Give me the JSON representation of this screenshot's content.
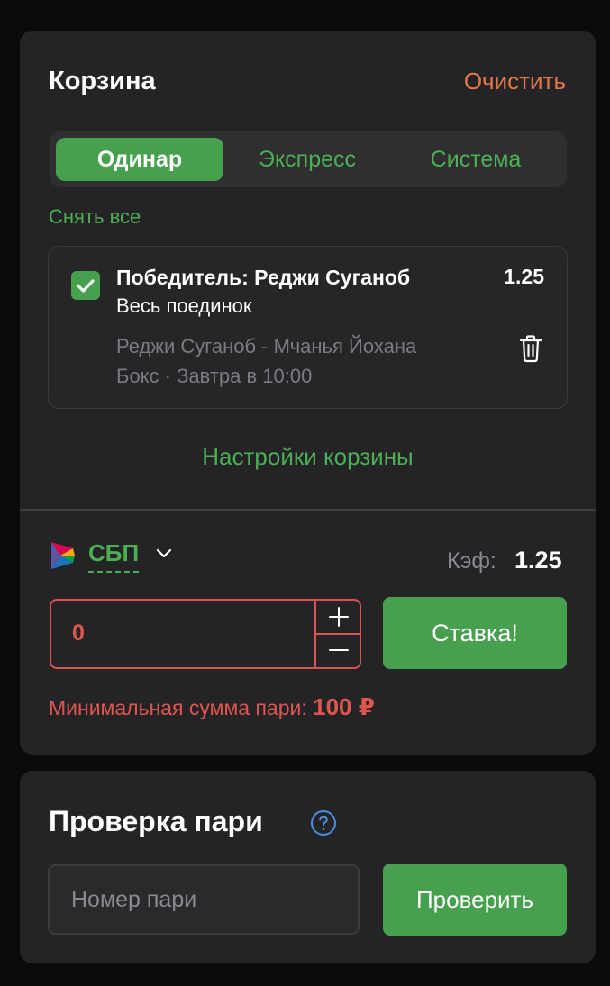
{
  "basket": {
    "title": "Корзина",
    "clear_label": "Очистить",
    "tabs": [
      {
        "label": "Одинар",
        "active": true
      },
      {
        "label": "Экспресс",
        "active": false
      },
      {
        "label": "Система",
        "active": false
      }
    ],
    "remove_all_label": "Снять все",
    "items": [
      {
        "checked": true,
        "title": "Победитель: Реджи Суганоб",
        "odds": "1.25",
        "market": "Весь поединок",
        "event": "Реджи Суганоб - Мчанья Йохана",
        "sport_time": "Бокс · Завтра в 10:00",
        "delete_icon": "trash-icon"
      }
    ],
    "settings_label": "Настройки корзины",
    "payment": {
      "method": "СБП",
      "logo_icon": "sbp-logo-icon",
      "chevron_icon": "chevron-down-icon"
    },
    "coef_label": "Кэф:",
    "coef_value": "1.25",
    "amount_value": "0",
    "stake_button": "Ставка!",
    "min_sum_label": "Минимальная сумма пари:",
    "min_sum_value": "100 ₽"
  },
  "check": {
    "title": "Проверка пари",
    "help_icon": "help-icon",
    "input_placeholder": "Номер пари",
    "button_label": "Проверить"
  },
  "colors": {
    "accent_green": "#47a04e",
    "link_green": "#4caf55",
    "clear_orange": "#e0784a",
    "error_red": "#e05550",
    "card_bg": "#242426",
    "page_bg": "#0b0b0c"
  }
}
